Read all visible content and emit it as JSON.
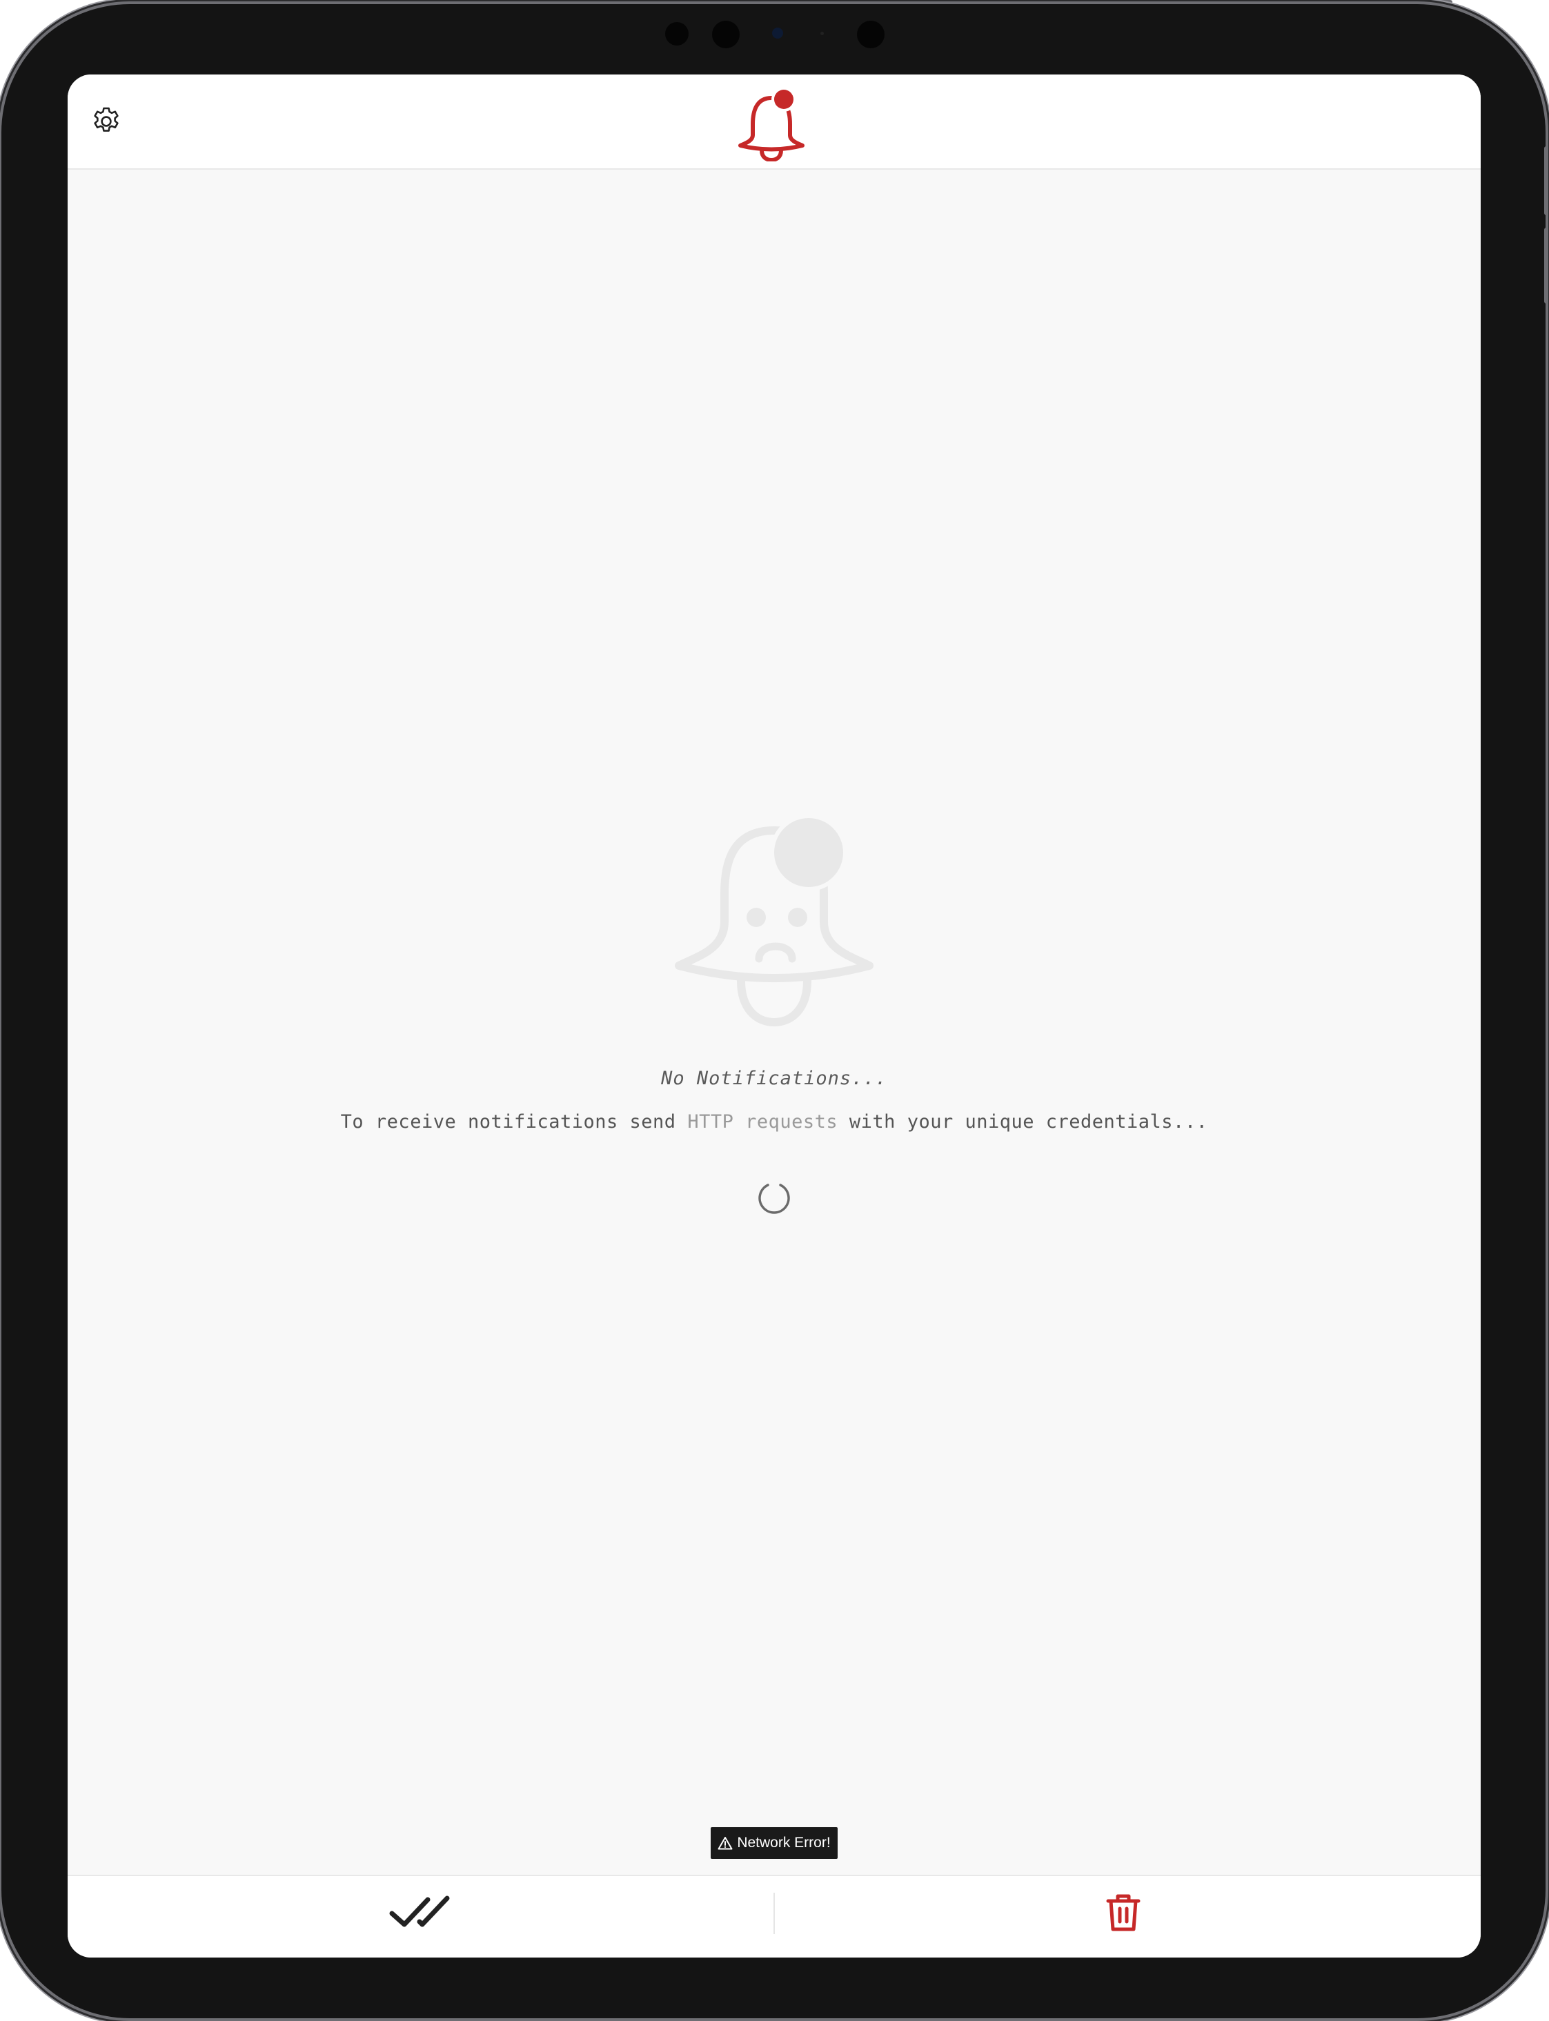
{
  "header": {
    "settings_icon": "gear-icon",
    "logo_icon": "bell-with-badge-icon"
  },
  "empty_state": {
    "icon": "sad-bell-icon",
    "title": "No Notifications...",
    "description_before": "To receive notifications send ",
    "description_highlight": "HTTP requests",
    "description_after": " with your unique credentials...",
    "loading_icon": "spinner-icon"
  },
  "toast": {
    "icon": "warning-icon",
    "text": "Network Error!"
  },
  "bottom_bar": {
    "mark_all_read_icon": "double-check-icon",
    "delete_all_icon": "trash-icon"
  },
  "colors": {
    "accent": "#c62828",
    "text_primary": "#222222",
    "text_muted": "#555555",
    "screen_background": "#f8f8f8",
    "toast_background": "#1a1a1a"
  }
}
